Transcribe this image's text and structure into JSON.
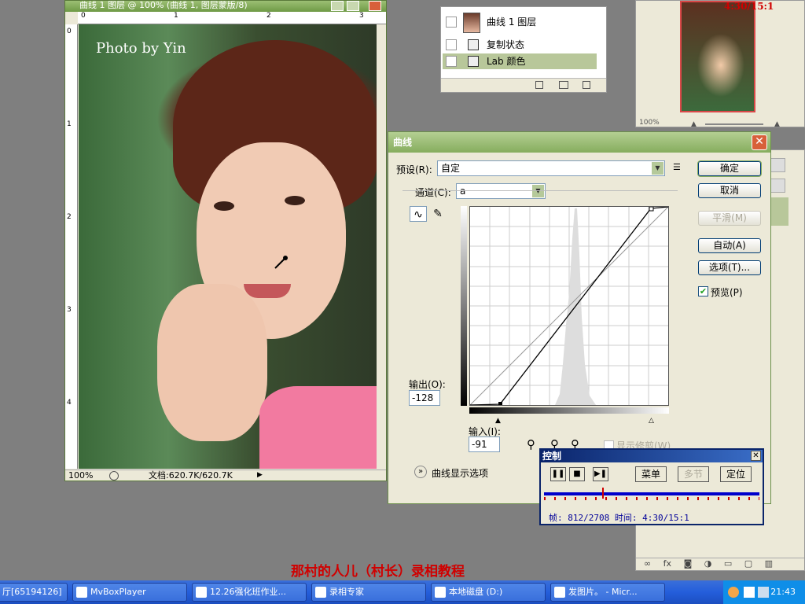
{
  "document": {
    "title": "曲线 1 图层 @ 100% (曲线 1, 图层蒙版/8)",
    "credit": "Photo by Yin",
    "zoom": "100%",
    "doc_info": "文档:620.7K/620.7K",
    "ruler_top": [
      "0",
      "1",
      "2",
      "3"
    ],
    "ruler_left": [
      "0",
      "1",
      "2",
      "3",
      "4"
    ]
  },
  "layers": {
    "items": [
      {
        "label": "曲线 1 图层",
        "selected": false
      },
      {
        "label": "复制状态",
        "selected": false
      },
      {
        "label": "Lab 颜色",
        "selected": true
      }
    ]
  },
  "navigator": {
    "zoom": "100%",
    "timecode": "4:30/15:1"
  },
  "curves": {
    "title": "曲线",
    "preset_label": "预设(R):",
    "preset_value": "自定",
    "channel_label": "通道(C):",
    "channel_value": "a",
    "output_label": "输出(O):",
    "output_value": "-128",
    "input_label": "输入(I):",
    "input_value": "-91",
    "show_clipping": "显示修剪(W)",
    "display_options": "曲线显示选项",
    "buttons": {
      "ok": "确定",
      "cancel": "取消",
      "smooth": "平滑(M)",
      "auto": "自动(A)",
      "options": "选项(T)..."
    },
    "preview_label": "预览(P)",
    "preview_checked": true
  },
  "control": {
    "title": "控制",
    "menu": "菜单",
    "section": "多节",
    "locate": "定位",
    "info": "帧: 812/2708 时间: 4:30/15:1",
    "progress": 0.27
  },
  "caption": "那村的人儿（村长）录相教程",
  "taskbar": {
    "items": [
      "厅[65194126]",
      "MvBoxPlayer",
      "12.26强化班作业...",
      "录相专家",
      "本地磁盘 (D:)",
      "发图片。 - Micr..."
    ],
    "clock": "21:43"
  }
}
